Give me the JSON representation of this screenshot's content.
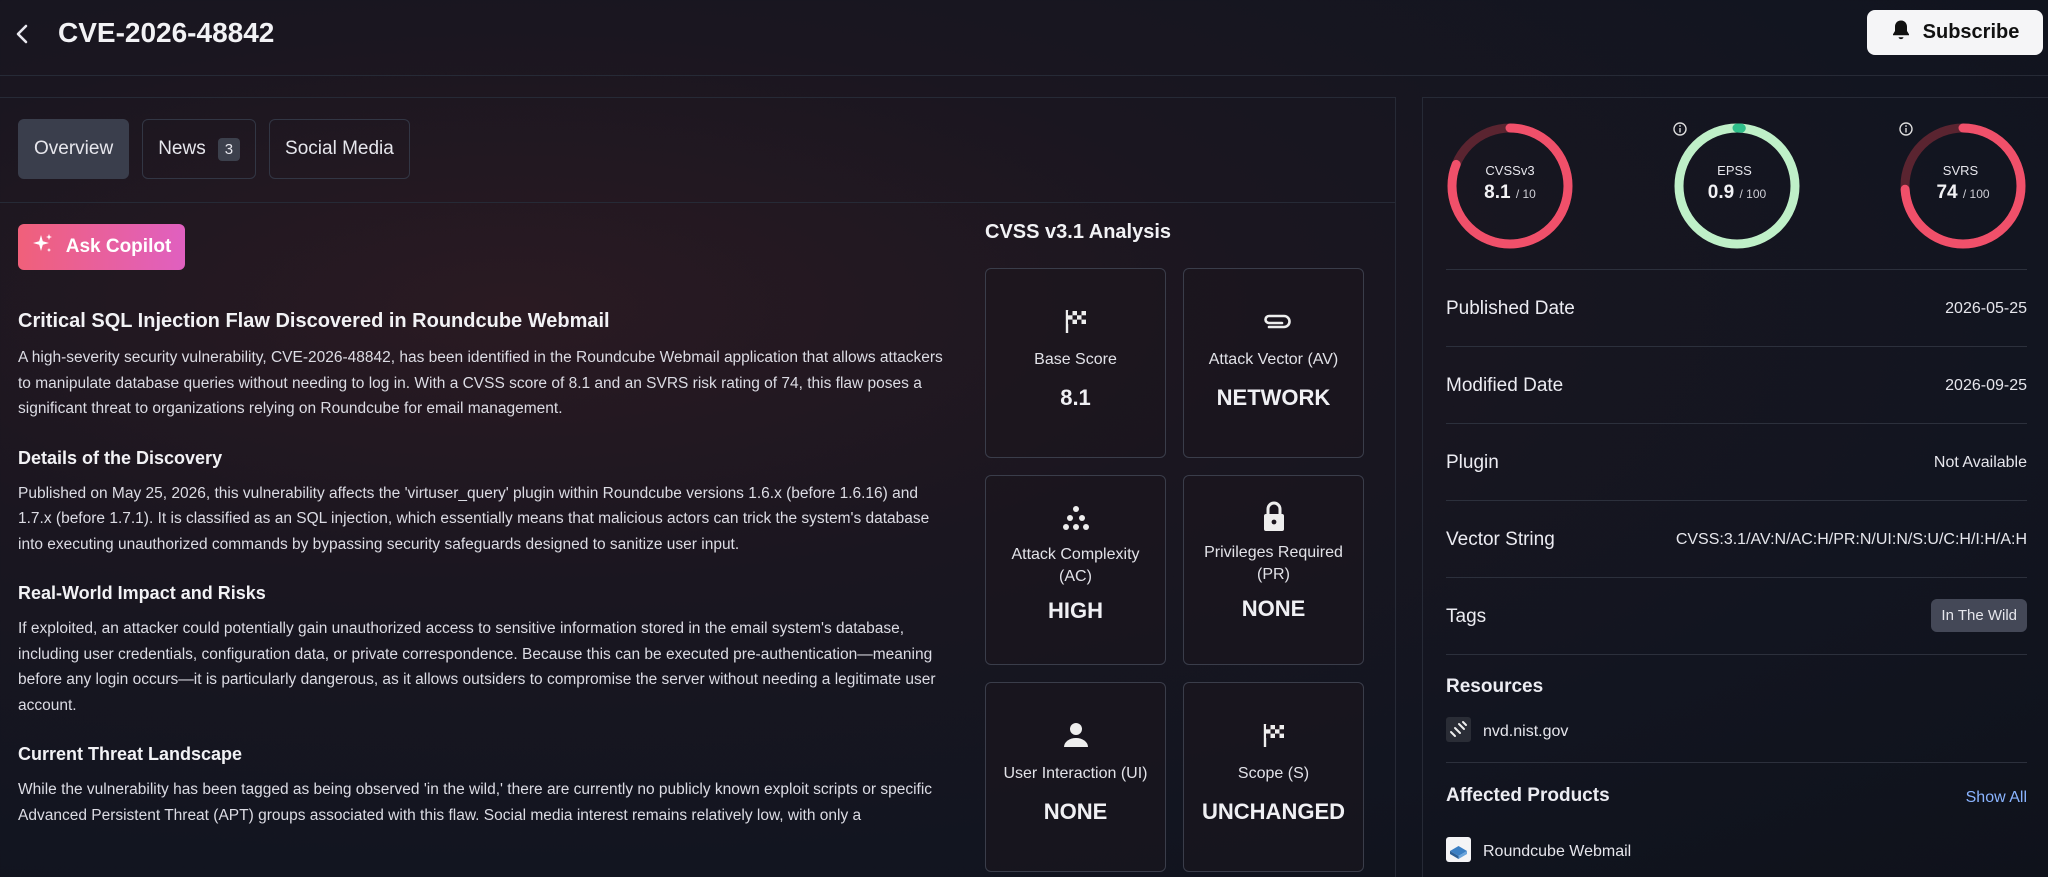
{
  "header": {
    "title": "CVE-2026-48842",
    "subscribe_label": "Subscribe"
  },
  "tabs": [
    {
      "label": "Overview",
      "badge": ""
    },
    {
      "label": "News",
      "badge": "3"
    },
    {
      "label": "Social Media",
      "badge": ""
    }
  ],
  "copilot": {
    "label": "Ask Copilot"
  },
  "article": {
    "title": "Critical SQL Injection Flaw Discovered in Roundcube Webmail",
    "intro": "A high-severity security vulnerability, CVE-2026-48842, has been identified in the Roundcube Webmail application that allows attackers to manipulate database queries without needing to log in. With a CVSS score of 8.1 and an SVRS risk rating of 74, this flaw poses a significant threat to organizations relying on Roundcube for email management.",
    "s1_title": "Details of the Discovery",
    "s1_body": "Published on May 25, 2026, this vulnerability affects the 'virtuser_query' plugin within Roundcube versions 1.6.x (before 1.6.16) and 1.7.x (before 1.7.1). It is classified as an SQL injection, which essentially means that malicious actors can trick the system's database into executing unauthorized commands by bypassing security safeguards designed to sanitize user input.",
    "s2_title": "Real-World Impact and Risks",
    "s2_body": "If exploited, an attacker could potentially gain unauthorized access to sensitive information stored in the email system's database, including user credentials, configuration data, or private correspondence. Because this can be executed pre-authentication—meaning before any login occurs—it is particularly dangerous, as it allows outsiders to compromise the server without needing a legitimate user account.",
    "s3_title": "Current Threat Landscape",
    "s3_body": "While the vulnerability has been tagged as being observed 'in the wild,' there are currently no publicly known exploit scripts or specific Advanced Persistent Threat (APT) groups associated with this flaw. Social media interest remains relatively low, with only a"
  },
  "cvss": {
    "title": "CVSS v3.1 Analysis",
    "metrics": [
      {
        "label": "Base Score",
        "value": "8.1",
        "icon": "flag-icon"
      },
      {
        "label": "Attack Vector (AV)",
        "value": "NETWORK",
        "icon": "paperclip-icon"
      },
      {
        "label": "Attack Complexity (AC)",
        "value": "HIGH",
        "icon": "dots-icon"
      },
      {
        "label": "Privileges Required (PR)",
        "value": "NONE",
        "icon": "lock-icon"
      },
      {
        "label": "User Interaction (UI)",
        "value": "NONE",
        "icon": "person-icon"
      },
      {
        "label": "Scope (S)",
        "value": "UNCHANGED",
        "icon": "flag-icon"
      }
    ]
  },
  "scores": [
    {
      "label": "CVSSv3",
      "value": "8.1",
      "max": "/ 10",
      "fraction": 0.81,
      "color": "#f0506a",
      "track": "#5a2430",
      "info": false
    },
    {
      "label": "EPSS",
      "value": "0.9",
      "max": "/ 100",
      "fraction": 0.009,
      "color": "#2fbf8a",
      "track": "#bff0c8",
      "info": true
    },
    {
      "label": "SVRS",
      "value": "74",
      "max": "/ 100",
      "fraction": 0.74,
      "color": "#f0506a",
      "track": "#5a2430",
      "info": true
    }
  ],
  "details": {
    "published_label": "Published Date",
    "published": "2026-05-25",
    "modified_label": "Modified Date",
    "modified": "2026-09-25",
    "plugin_label": "Plugin",
    "plugin": "Not Available",
    "vector_label": "Vector String",
    "vector": "CVSS:3.1/AV:N/AC:H/PR:N/UI:N/S:U/C:H/I:H/A:H",
    "tags_label": "Tags",
    "tag": "In The Wild",
    "resources_label": "Resources",
    "resource": "nvd.nist.gov",
    "affected_label": "Affected Products",
    "show_all": "Show All",
    "product": "Roundcube Webmail"
  }
}
